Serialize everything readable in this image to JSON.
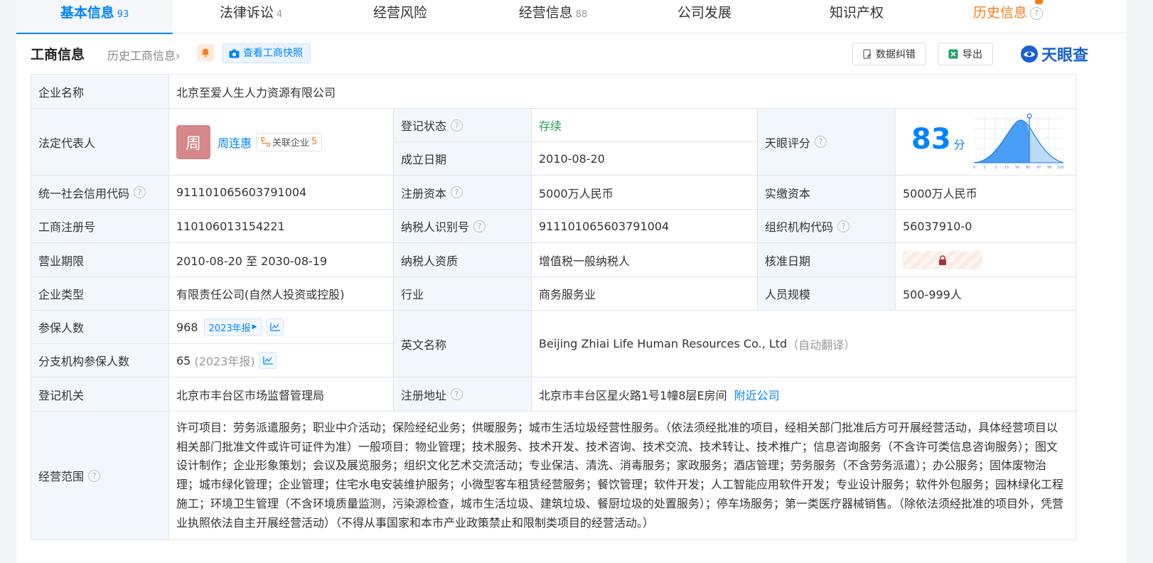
{
  "tabs": [
    {
      "label": "基本信息",
      "count": "93"
    },
    {
      "label": "法律诉讼",
      "count": "4"
    },
    {
      "label": "经营风险",
      "count": ""
    },
    {
      "label": "经营信息",
      "count": "88"
    },
    {
      "label": "公司发展",
      "count": ""
    },
    {
      "label": "知识产权",
      "count": ""
    },
    {
      "label": "历史信息",
      "count": ""
    }
  ],
  "header": {
    "title": "工商信息",
    "history_link": "历史工商信息",
    "snapshot_btn": "查看工商快照",
    "correct_btn": "数据纠错",
    "export_btn": "导出",
    "logo_text": "天眼查"
  },
  "info": {
    "company_name_label": "企业名称",
    "company_name": "北京至爱人生人力资源有限公司",
    "legal_rep_label": "法定代表人",
    "legal_rep_avatar": "周",
    "legal_rep_name": "周连惠",
    "related_label": "关联企业",
    "related_count": "5",
    "reg_status_label": "登记状态",
    "reg_status": "存续",
    "est_date_label": "成立日期",
    "est_date": "2010-08-20",
    "score_label": "天眼评分",
    "score": "83",
    "score_unit": "分",
    "score_ticks": [
      "0",
      "1",
      "3",
      "15",
      "50",
      "85",
      "97",
      "99",
      "100"
    ],
    "credit_code_label": "统一社会信用代码",
    "credit_code": "911101065603791004",
    "reg_capital_label": "注册资本",
    "reg_capital": "5000万人民币",
    "paid_capital_label": "实缴资本",
    "paid_capital": "5000万人民币",
    "biz_reg_no_label": "工商注册号",
    "biz_reg_no": "110106013154221",
    "taxpayer_id_label": "纳税人识别号",
    "taxpayer_id": "911101065603791004",
    "org_code_label": "组织机构代码",
    "org_code": "56037910-0",
    "term_label": "营业期限",
    "term": "2010-08-20 至 2030-08-19",
    "taxpayer_qual_label": "纳税人资质",
    "taxpayer_qual": "增值税一般纳税人",
    "approve_date_label": "核准日期",
    "company_type_label": "企业类型",
    "company_type": "有限责任公司(自然人投资或控股)",
    "industry_label": "行业",
    "industry": "商务服务业",
    "staff_size_label": "人员规模",
    "staff_size": "500-999人",
    "insured_label": "参保人数",
    "insured": "968",
    "insured_year_tag": "2023年报",
    "english_name_label": "英文名称",
    "english_name": "Beijing Zhiai Life Human Resources Co., Ltd",
    "english_note": "（自动翻译）",
    "branch_insured_label": "分支机构参保人数",
    "branch_insured": "65",
    "branch_insured_year": "(2023年报)",
    "reg_authority_label": "登记机关",
    "reg_authority": "北京市丰台区市场监督管理局",
    "reg_address_label": "注册地址",
    "reg_address": "北京市丰台区星火路1号1幢8层E房间",
    "nearby_link": "附近公司",
    "scope_label": "经营范围",
    "scope": "许可项目：劳务派遣服务；职业中介活动；保险经纪业务；供暖服务；城市生活垃圾经营性服务。（依法须经批准的项目，经相关部门批准后方可开展经营活动，具体经营项目以相关部门批准文件或许可证件为准）一般项目：物业管理；技术服务、技术开发、技术咨询、技术交流、技术转让、技术推广；信息咨询服务（不含许可类信息咨询服务）；图文设计制作；企业形象策划；会议及展览服务；组织文化艺术交流活动；专业保洁、清洗、消毒服务；家政服务；酒店管理；劳务服务（不含劳务派遣）；办公服务；固体废物治理；城市绿化管理；企业管理；住宅水电安装维护服务；小微型客车租赁经营服务；餐饮管理；软件开发；人工智能应用软件开发；专业设计服务；软件外包服务；园林绿化工程施工；环境卫生管理（不含环境质量监测，污染源检查，城市生活垃圾、建筑垃圾、餐厨垃圾的处置服务）；停车场服务；第一类医疗器械销售。（除依法须经批准的项目外，凭营业执照依法自主开展经营活动）（不得从事国家和本市产业政策禁止和限制类项目的经营活动。）"
  },
  "colors": {
    "accent": "#0084ff",
    "label_bg": "#f2f7fd",
    "status_green": "#22a04b",
    "history_orange": "#ff7a18"
  }
}
